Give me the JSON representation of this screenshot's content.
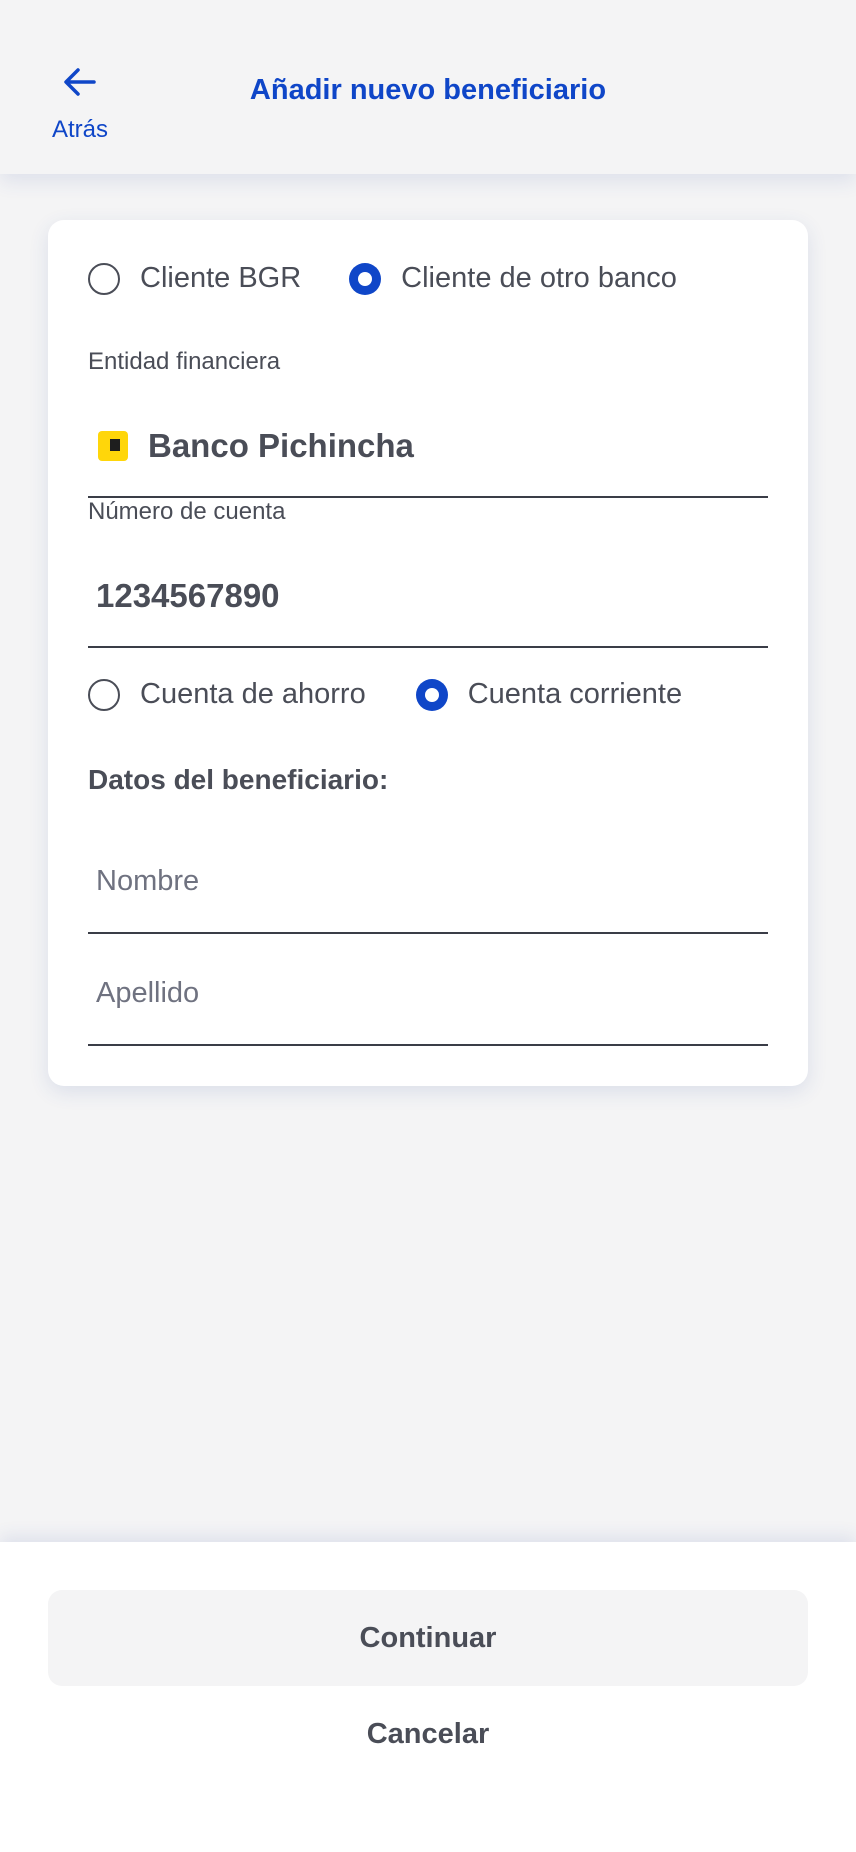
{
  "header": {
    "title": "Añadir nuevo beneficiario",
    "back_label": "Atrás",
    "back_icon": "arrow-left-icon"
  },
  "client_type": {
    "options": [
      {
        "label": "Cliente BGR",
        "selected": false
      },
      {
        "label": "Cliente de otro banco",
        "selected": true
      }
    ]
  },
  "bank": {
    "label": "Entidad financiera",
    "value": "Banco Pichincha",
    "logo_color": "#ffd60a"
  },
  "account": {
    "label": "Número de cuenta",
    "value": "1234567890"
  },
  "account_type": {
    "options": [
      {
        "label": "Cuenta de ahorro",
        "selected": false
      },
      {
        "label": "Cuenta corriente",
        "selected": true
      }
    ]
  },
  "beneficiary": {
    "section_title": "Datos del beneficiario:",
    "first_name_placeholder": "Nombre",
    "last_name_placeholder": "Apellido"
  },
  "footer": {
    "continue_label": "Continuar",
    "cancel_label": "Cancelar"
  },
  "colors": {
    "accent": "#0f46c8",
    "text": "#4a4d57",
    "background": "#f4f4f5"
  }
}
